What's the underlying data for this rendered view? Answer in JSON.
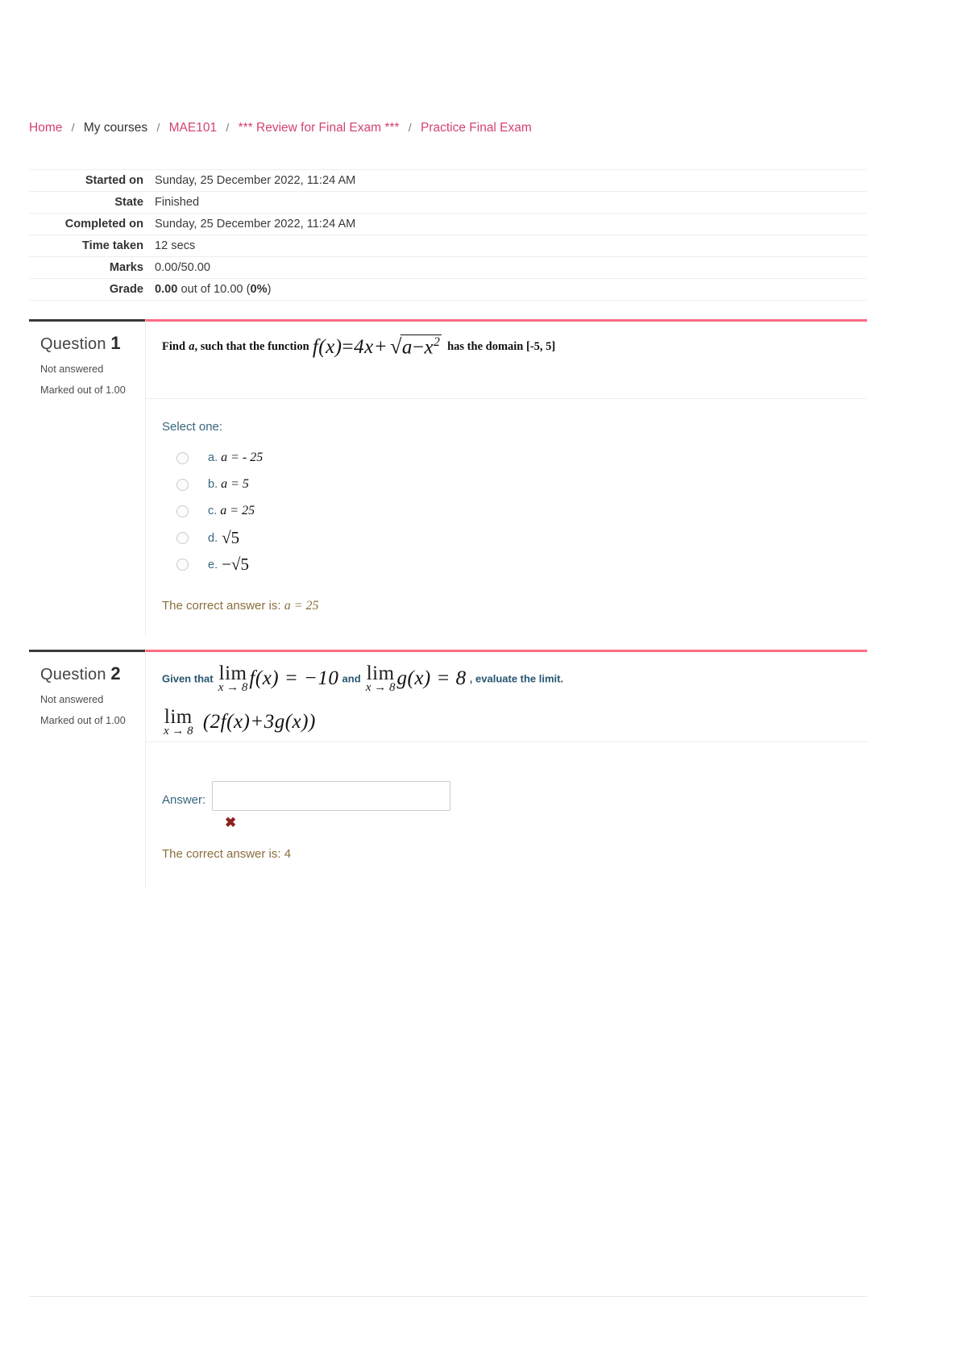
{
  "breadcrumb": {
    "items": [
      {
        "label": "Home",
        "type": "link"
      },
      {
        "label": "My courses",
        "type": "plain"
      },
      {
        "label": "MAE101",
        "type": "link"
      },
      {
        "label": "*** Review for Final Exam ***",
        "type": "link"
      },
      {
        "label": "Practice Final Exam",
        "type": "link"
      }
    ],
    "separator": "/"
  },
  "summary": {
    "rows": [
      {
        "label": "Started on",
        "value": "Sunday, 25 December 2022, 11:24 AM"
      },
      {
        "label": "State",
        "value": "Finished"
      },
      {
        "label": "Completed on",
        "value": "Sunday, 25 December 2022, 11:24 AM"
      },
      {
        "label": "Time taken",
        "value": "12 secs"
      },
      {
        "label": "Marks",
        "value": "0.00/50.00"
      }
    ],
    "grade": {
      "label": "Grade",
      "value_bold": "0.00",
      "value_mid": " out of 10.00 (",
      "value_pct": "0%",
      "value_end": ")"
    }
  },
  "question1": {
    "title_word": "Question",
    "number": "1",
    "state": "Not answered",
    "marks": "Marked out of 1.00",
    "text": {
      "lead": "Find",
      "var_a": "a",
      "mid": ", such that the function",
      "fx": "f(x)",
      "equals": "=",
      "term": "4x+",
      "radicand_a": "a",
      "radicand_minus": "−",
      "radicand_x": "x",
      "radicand_exp": "2",
      "tail": "has the domain [-5, 5]"
    },
    "select_one_label": "Select one:",
    "options": [
      {
        "letter": "a.",
        "value": "a = - 25",
        "kind": "text"
      },
      {
        "letter": "b.",
        "value": "a = 5",
        "kind": "text"
      },
      {
        "letter": "c.",
        "value": "a = 25",
        "kind": "text"
      },
      {
        "letter": "d.",
        "value": "√5",
        "kind": "radical"
      },
      {
        "letter": "e.",
        "value": "−√5",
        "kind": "radical"
      }
    ],
    "correct_answer_prefix": "The correct answer is:",
    "correct_answer_value": "a = 25"
  },
  "question2": {
    "title_word": "Question",
    "number": "2",
    "state": "Not answered",
    "marks": "Marked out of 1.00",
    "text": {
      "given_that": "Given that",
      "lim_top": "lim",
      "lim_bot": "x → 8",
      "fx_eq": "f(x) = −10",
      "and": "and",
      "gx_eq": "g(x) = 8",
      "evaluate": ", evaluate the limit.",
      "expression": "(2f(x)+3g(x))"
    },
    "answer_label": "Answer:",
    "answer_value": "",
    "answer_placeholder": "",
    "wrong_mark": "✖",
    "correct_answer_prefix": "The correct answer is:",
    "correct_answer_value": "4"
  },
  "colors": {
    "link": "#d3436d",
    "question_top_border": "#373a3c",
    "body_top_border": "#ff6b81",
    "option_text": "#36657c",
    "correct_text": "#8a6d3b",
    "wrong_mark": "#8e2020"
  }
}
